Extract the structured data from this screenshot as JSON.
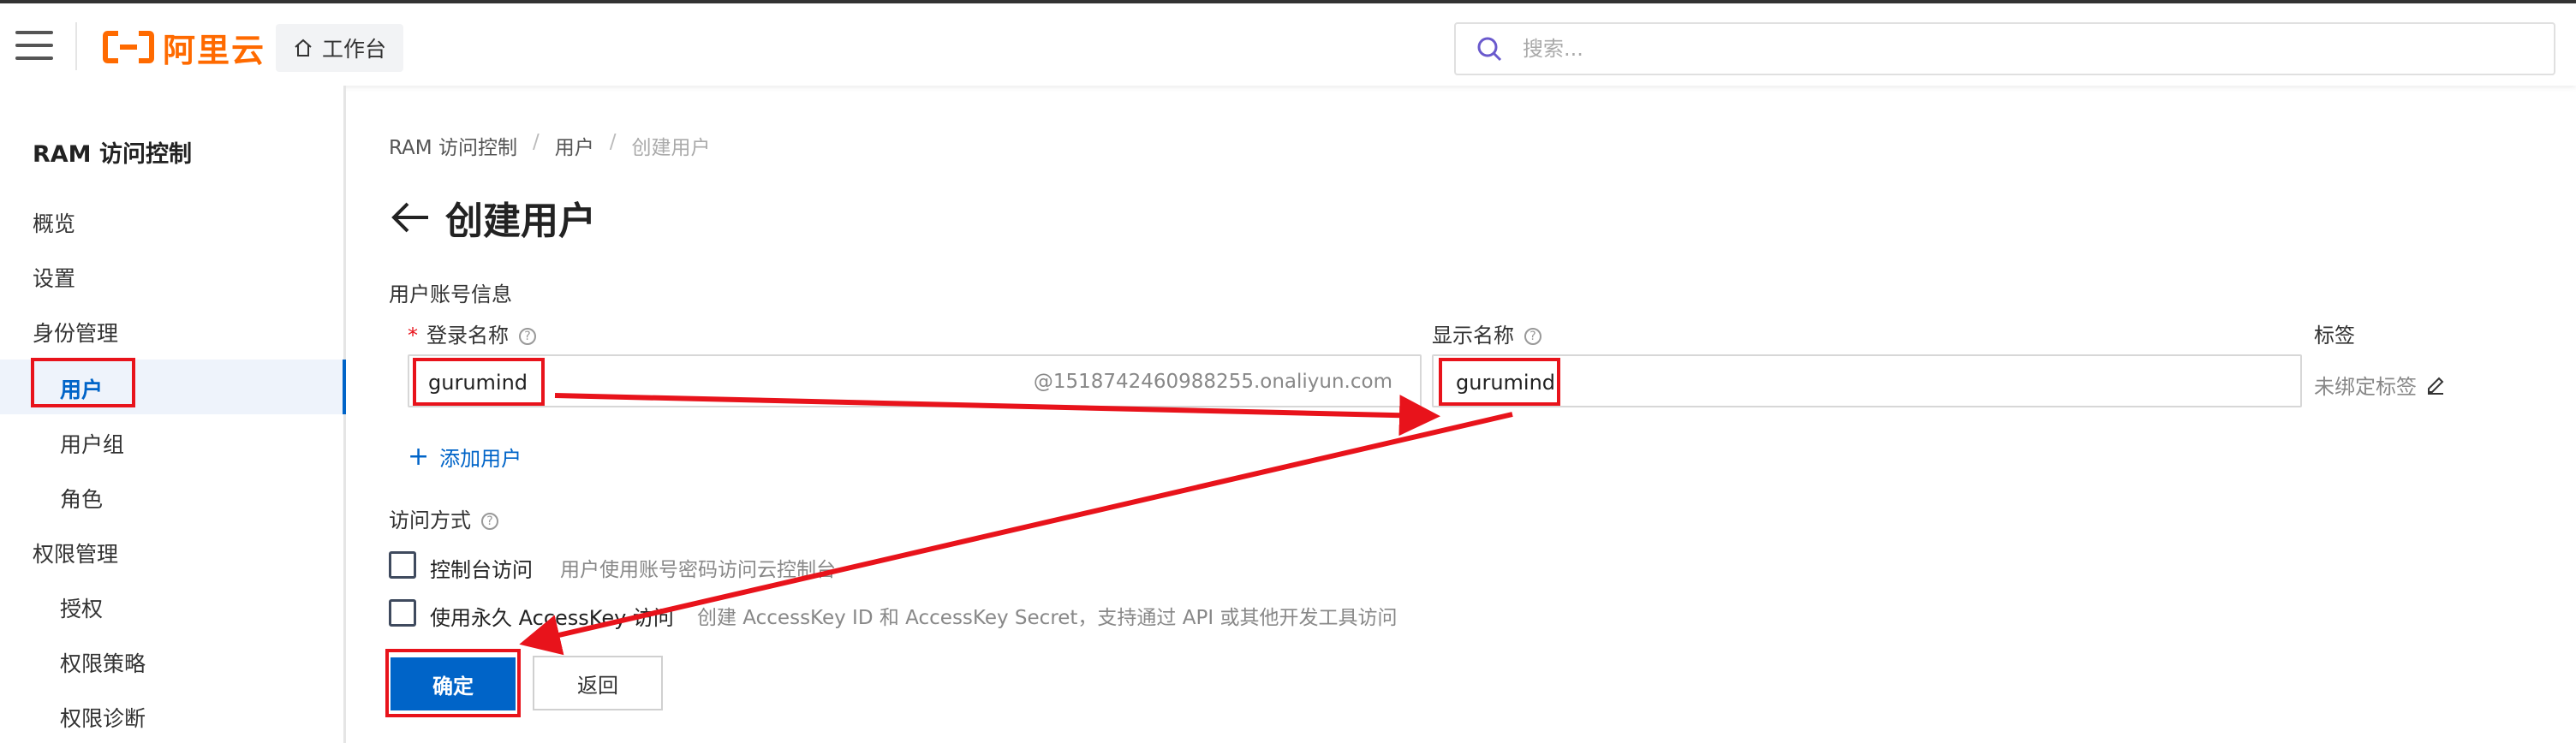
{
  "topbar": {
    "logo_text": "阿里云",
    "workbench_label": "工作台",
    "search_placeholder": "搜索..."
  },
  "sidebar": {
    "title": "RAM 访问控制",
    "items": [
      {
        "label": "概览"
      },
      {
        "label": "设置"
      },
      {
        "label": "身份管理"
      },
      {
        "label": "用户"
      },
      {
        "label": "用户组"
      },
      {
        "label": "角色"
      },
      {
        "label": "权限管理"
      },
      {
        "label": "授权"
      },
      {
        "label": "权限策略"
      },
      {
        "label": "权限诊断"
      }
    ]
  },
  "breadcrumb": [
    "RAM 访问控制",
    "用户",
    "创建用户"
  ],
  "page_title": "创建用户",
  "form": {
    "section_account": "用户账号信息",
    "login_name_label": "登录名称",
    "login_name_value": "gurumind",
    "login_name_suffix": "@1518742460988255.onaliyun.com",
    "display_name_label": "显示名称",
    "display_name_value": "gurumind",
    "tag_label": "标签",
    "tag_value": "未绑定标签",
    "add_user_label": "添加用户",
    "access_label": "访问方式",
    "console_access_label": "控制台访问",
    "console_access_desc": "用户使用账号密码访问云控制台",
    "accesskey_label": "使用永久 AccessKey 访问",
    "accesskey_desc": "创建 AccessKey ID 和 AccessKey Secret，支持通过 API 或其他开发工具访问",
    "confirm_button": "确定",
    "back_button": "返回"
  },
  "colors": {
    "brand": "#ff6a00",
    "primary": "#0064c8",
    "annotation": "#e8131b"
  }
}
